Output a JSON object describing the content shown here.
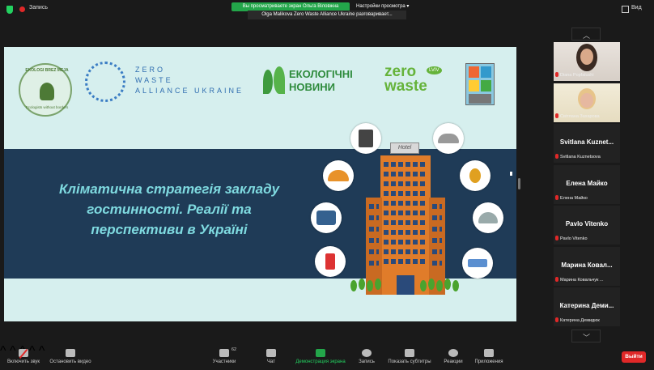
{
  "topbar": {
    "recording_label": "Запись",
    "viewing_banner": "Вы просматриваете экран Ольга Віловжна",
    "view_options": "Настройки просмотра ▾",
    "speaking": "Olga Malikova Zero Waste Alliance Ukraine разговаривает...",
    "view_label": "Вид"
  },
  "slide": {
    "logo_ebm_top": "EKOLOGI BREZ MEJA",
    "logo_ebm_bottom": "Ecologists without borders",
    "zw_line1": "ZERO",
    "zw_line2": "WASTE",
    "zw_line3": "ALLIANCE UKRAINE",
    "eco_news_line1": "ЕКОЛОГІЧНІ",
    "eco_news_line2": "НОВИНИ",
    "zero_text": "zero",
    "waste_text": "waste",
    "lviv_text": "LVIV",
    "hotel_sign": "Hotel",
    "title_line1": "Кліматична стратегія закладу",
    "title_line2": "гостинності. Реалії та",
    "title_line3": "перспективи в Україні"
  },
  "participants": [
    {
      "display": "",
      "footer": "Diana Popfalushi",
      "has_video": true
    },
    {
      "display": "",
      "footer": "Світлана Захарова",
      "has_video": true
    },
    {
      "display": "Svitlana Kuznet...",
      "footer": "Svitlana Kuznetsova",
      "has_video": false
    },
    {
      "display": "Елена Майко",
      "footer": "Елена Майко",
      "has_video": false
    },
    {
      "display": "Pavlo Vitenko",
      "footer": "Pavlo Vitenko",
      "has_video": false
    },
    {
      "display": "Марина Ковал...",
      "footer": "Марина Ковальчук ...",
      "has_video": false
    },
    {
      "display": "Катерина Деми...",
      "footer": "Катерина Демидюк",
      "has_video": false
    }
  ],
  "toolbar": {
    "unmute": "Включить звук",
    "stop_video": "Остановить видео",
    "participants": "Участники",
    "participants_count": "62",
    "chat": "Чат",
    "share_screen": "Демонстрация экрана",
    "record": "Запись",
    "subtitles": "Показать субтитры",
    "reactions": "Реакции",
    "apps": "Приложения",
    "leave": "Выйти"
  },
  "colors": {
    "band": "#1f3b57",
    "title": "#7fdae0",
    "slide_bg": "#d6efee",
    "leave": "#e02828",
    "share_green": "#23a64a"
  }
}
